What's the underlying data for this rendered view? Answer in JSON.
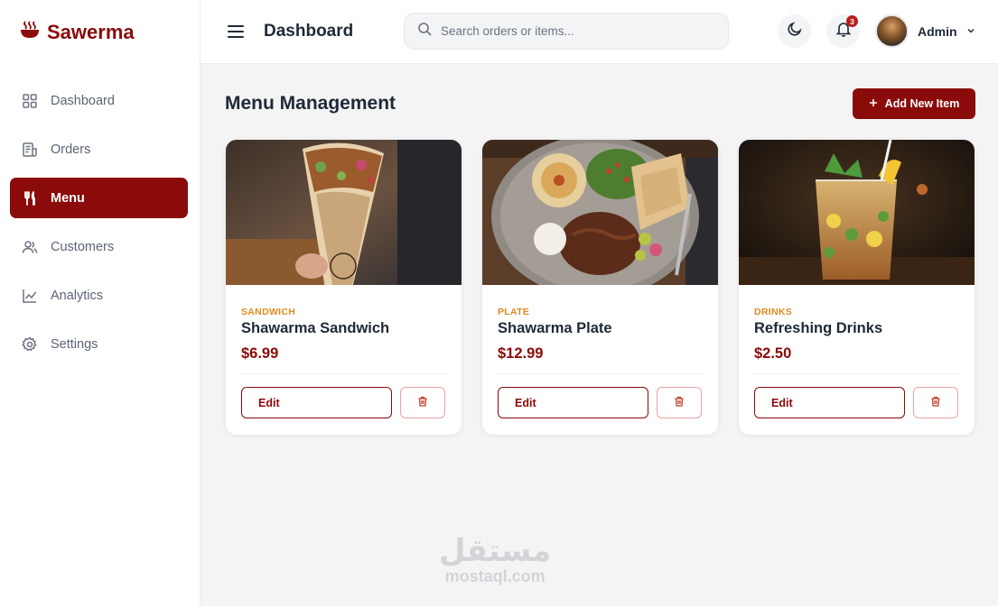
{
  "brand": {
    "name": "Sawerma",
    "color": "#8b0a0a",
    "icon": "bowl-steam-icon"
  },
  "sidebar": {
    "items": [
      {
        "label": "Dashboard",
        "icon": "grid-icon",
        "active": false
      },
      {
        "label": "Orders",
        "icon": "receipt-icon",
        "active": false
      },
      {
        "label": "Menu",
        "icon": "utensils-icon",
        "active": true
      },
      {
        "label": "Customers",
        "icon": "users-icon",
        "active": false
      },
      {
        "label": "Analytics",
        "icon": "chart-line-icon",
        "active": false
      },
      {
        "label": "Settings",
        "icon": "gear-icon",
        "active": false
      }
    ]
  },
  "header": {
    "title": "Dashboard",
    "search_placeholder": "Search orders or items...",
    "notification_count": "3",
    "user_name": "Admin"
  },
  "main": {
    "title": "Menu Management",
    "add_button": "Add New Item",
    "items": [
      {
        "category": "SANDWICH",
        "name": "Shawarma Sandwich",
        "price": "$6.99",
        "edit_label": "Edit"
      },
      {
        "category": "PLATE",
        "name": "Shawarma Plate",
        "price": "$12.99",
        "edit_label": "Edit"
      },
      {
        "category": "DRINKS",
        "name": "Refreshing Drinks",
        "price": "$2.50",
        "edit_label": "Edit"
      }
    ]
  },
  "watermark": {
    "arabic": "مستقل",
    "latin": "mostaql.com"
  },
  "colors": {
    "accent": "#8b0a0a",
    "category": "#e08a1e",
    "background": "#f4f4f5"
  }
}
